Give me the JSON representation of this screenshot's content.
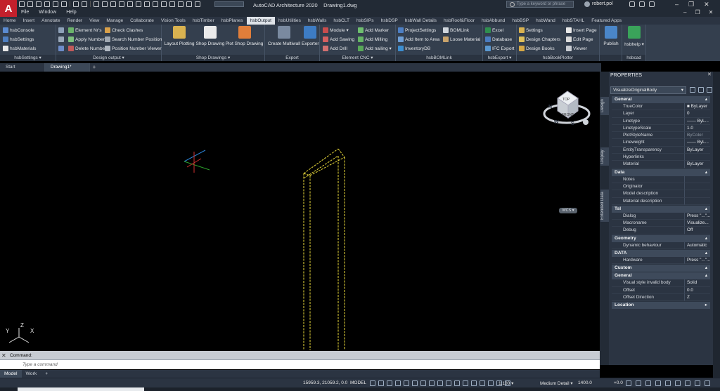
{
  "app": {
    "logo": "A",
    "title": "AutoCAD Architecture 2020",
    "document": "Drawing1.dwg",
    "search_placeholder": "Type a keyword or phrase",
    "user": "robert.pol"
  },
  "menu": [
    "File",
    "Window",
    "Help"
  ],
  "ribbon_tabs": [
    "Home",
    "Insert",
    "Annotate",
    "Render",
    "View",
    "Manage",
    "Collaborate",
    "Vision Tools",
    "hsbTimber",
    "hsbPlanes",
    "hsbOutput",
    "hsbUtilities",
    "hsbWalls",
    "hsbCLT",
    "hsbSIPs",
    "hsbDSP",
    "hsbWall Details",
    "hsbRoof&Floor",
    "hsbAbbund",
    "hsbBSP",
    "hsbWand",
    "hsbSTAHL",
    "Featured Apps"
  ],
  "active_tab": "hsbOutput",
  "panels": {
    "settings": {
      "label": "hsbSettings ▾",
      "items": [
        "hsbConsole",
        "hsbSettings",
        "hsbMaterials"
      ]
    },
    "design_output": {
      "label": "Design output ▾",
      "items": [
        "Element Nr's",
        "Apply Numbers",
        "Delete Numbers",
        "Check Clashes",
        "Search Number Position",
        "Position Number Viewer"
      ]
    },
    "shop_drawings": {
      "label": "Shop Drawings ▾",
      "items": [
        "Layout Plotting",
        "Shop Drawing",
        "Plot Shop Drawing"
      ]
    },
    "export": {
      "label": "Export",
      "items": [
        "Create Multiwall",
        "Exporter"
      ]
    },
    "cnc": {
      "label": "Element CNC ▾",
      "items": [
        "Module ▾",
        "Add Sawing",
        "Add Drill",
        "Add Marker",
        "Add Milling",
        "Add nailing ▾"
      ]
    },
    "bomlink": {
      "label": "hsbBOMLink",
      "items": [
        "ProjectSettings",
        "Add Item to Area",
        "InventoryDB",
        "BOMLink",
        "Loose Material"
      ]
    },
    "hsbexport": {
      "label": "hsbExport ▾",
      "items": [
        "Excel",
        "Database",
        "IFC Export"
      ]
    },
    "bookplotter": {
      "label": "hsbBookPlotter",
      "items": [
        "Settings",
        "Design Chapters",
        "Design Books",
        "Insert Page",
        "Edit Page",
        "Viewer"
      ]
    },
    "publish": {
      "label": "",
      "items": [
        "Publish"
      ]
    },
    "hsbcad": {
      "label": "hsbcad",
      "items": [
        "hsbhelp ▾"
      ]
    }
  },
  "doc_tabs": [
    "Start",
    "Drawing1*",
    "+"
  ],
  "viewcube": {
    "top": "TOP",
    "front": "FRONT",
    "n": "N",
    "s": "S",
    "w": "W",
    "wcs": "WCS ▾"
  },
  "ucs": {
    "x": "X",
    "y": "Y",
    "z": "Z"
  },
  "command": {
    "history": "Command:",
    "placeholder": "Type a command"
  },
  "layout_tabs": [
    "Model",
    "Work",
    "+"
  ],
  "status": {
    "coords": "15959.3, 21059.2, 0.0",
    "space": "MODEL",
    "scale": "1:100 ▾",
    "detail": "Medium Detail ▾",
    "cut": "1400.0",
    "elev": "+0.0"
  },
  "properties": {
    "title": "PROPERTIES",
    "selection": "VisualizeOriginalBody",
    "side_tabs": [
      "Design",
      "Display",
      "Extended Data"
    ],
    "sections": [
      {
        "name": "General",
        "collapsed": false,
        "rows": [
          {
            "name": "TrueColor",
            "value": "■ ByLayer",
            "dim": false
          },
          {
            "name": "Layer",
            "value": "0",
            "dim": false
          },
          {
            "name": "Linetype",
            "value": "—— ByL...",
            "dim": false
          },
          {
            "name": "LinetypeScale",
            "value": "1.0",
            "dim": false
          },
          {
            "name": "PlotStyleName",
            "value": "ByColor",
            "dim": true
          },
          {
            "name": "Lineweight",
            "value": "—— ByL...",
            "dim": false
          },
          {
            "name": "EntityTransparency",
            "value": "ByLayer",
            "dim": false
          },
          {
            "name": "Hyperlinks",
            "value": "",
            "dim": false
          },
          {
            "name": "Material",
            "value": "ByLayer",
            "dim": false
          }
        ]
      },
      {
        "name": "Data",
        "collapsed": false,
        "rows": [
          {
            "name": "Notes",
            "value": "",
            "dim": false
          },
          {
            "name": "Originator",
            "value": "",
            "dim": false
          },
          {
            "name": "Model description",
            "value": "",
            "dim": false
          },
          {
            "name": "Material description",
            "value": "",
            "dim": false
          }
        ]
      },
      {
        "name": "Tsl",
        "collapsed": false,
        "rows": [
          {
            "name": "Dialog",
            "value": "Press \"...\"...",
            "dim": false
          },
          {
            "name": "Macroname",
            "value": "Visualize...",
            "dim": false
          },
          {
            "name": "Debug",
            "value": "Off",
            "dim": false
          }
        ]
      },
      {
        "name": "Geometry",
        "collapsed": false,
        "rows": [
          {
            "name": "Dynamic behaviour",
            "value": "Automatic",
            "dim": false
          }
        ]
      },
      {
        "name": "DATA",
        "collapsed": false,
        "rows": [
          {
            "name": "Hardware",
            "value": "Press \"...\"...",
            "dim": false
          }
        ]
      },
      {
        "name": "Custom",
        "collapsed": false,
        "rows": []
      },
      {
        "name": "General",
        "collapsed": false,
        "rows": [
          {
            "name": "Visual style invalid body",
            "value": "Solid",
            "dim": false
          },
          {
            "name": "Offset",
            "value": "0.0",
            "dim": false
          },
          {
            "name": "Offset Direction",
            "value": "Z",
            "dim": false
          }
        ]
      },
      {
        "name": "Location",
        "collapsed": true,
        "rows": []
      }
    ]
  },
  "colors": {
    "accent": "#c3202c",
    "viewport": "#000000",
    "object": "#e8d83a",
    "ribbon": "#343f4e"
  }
}
